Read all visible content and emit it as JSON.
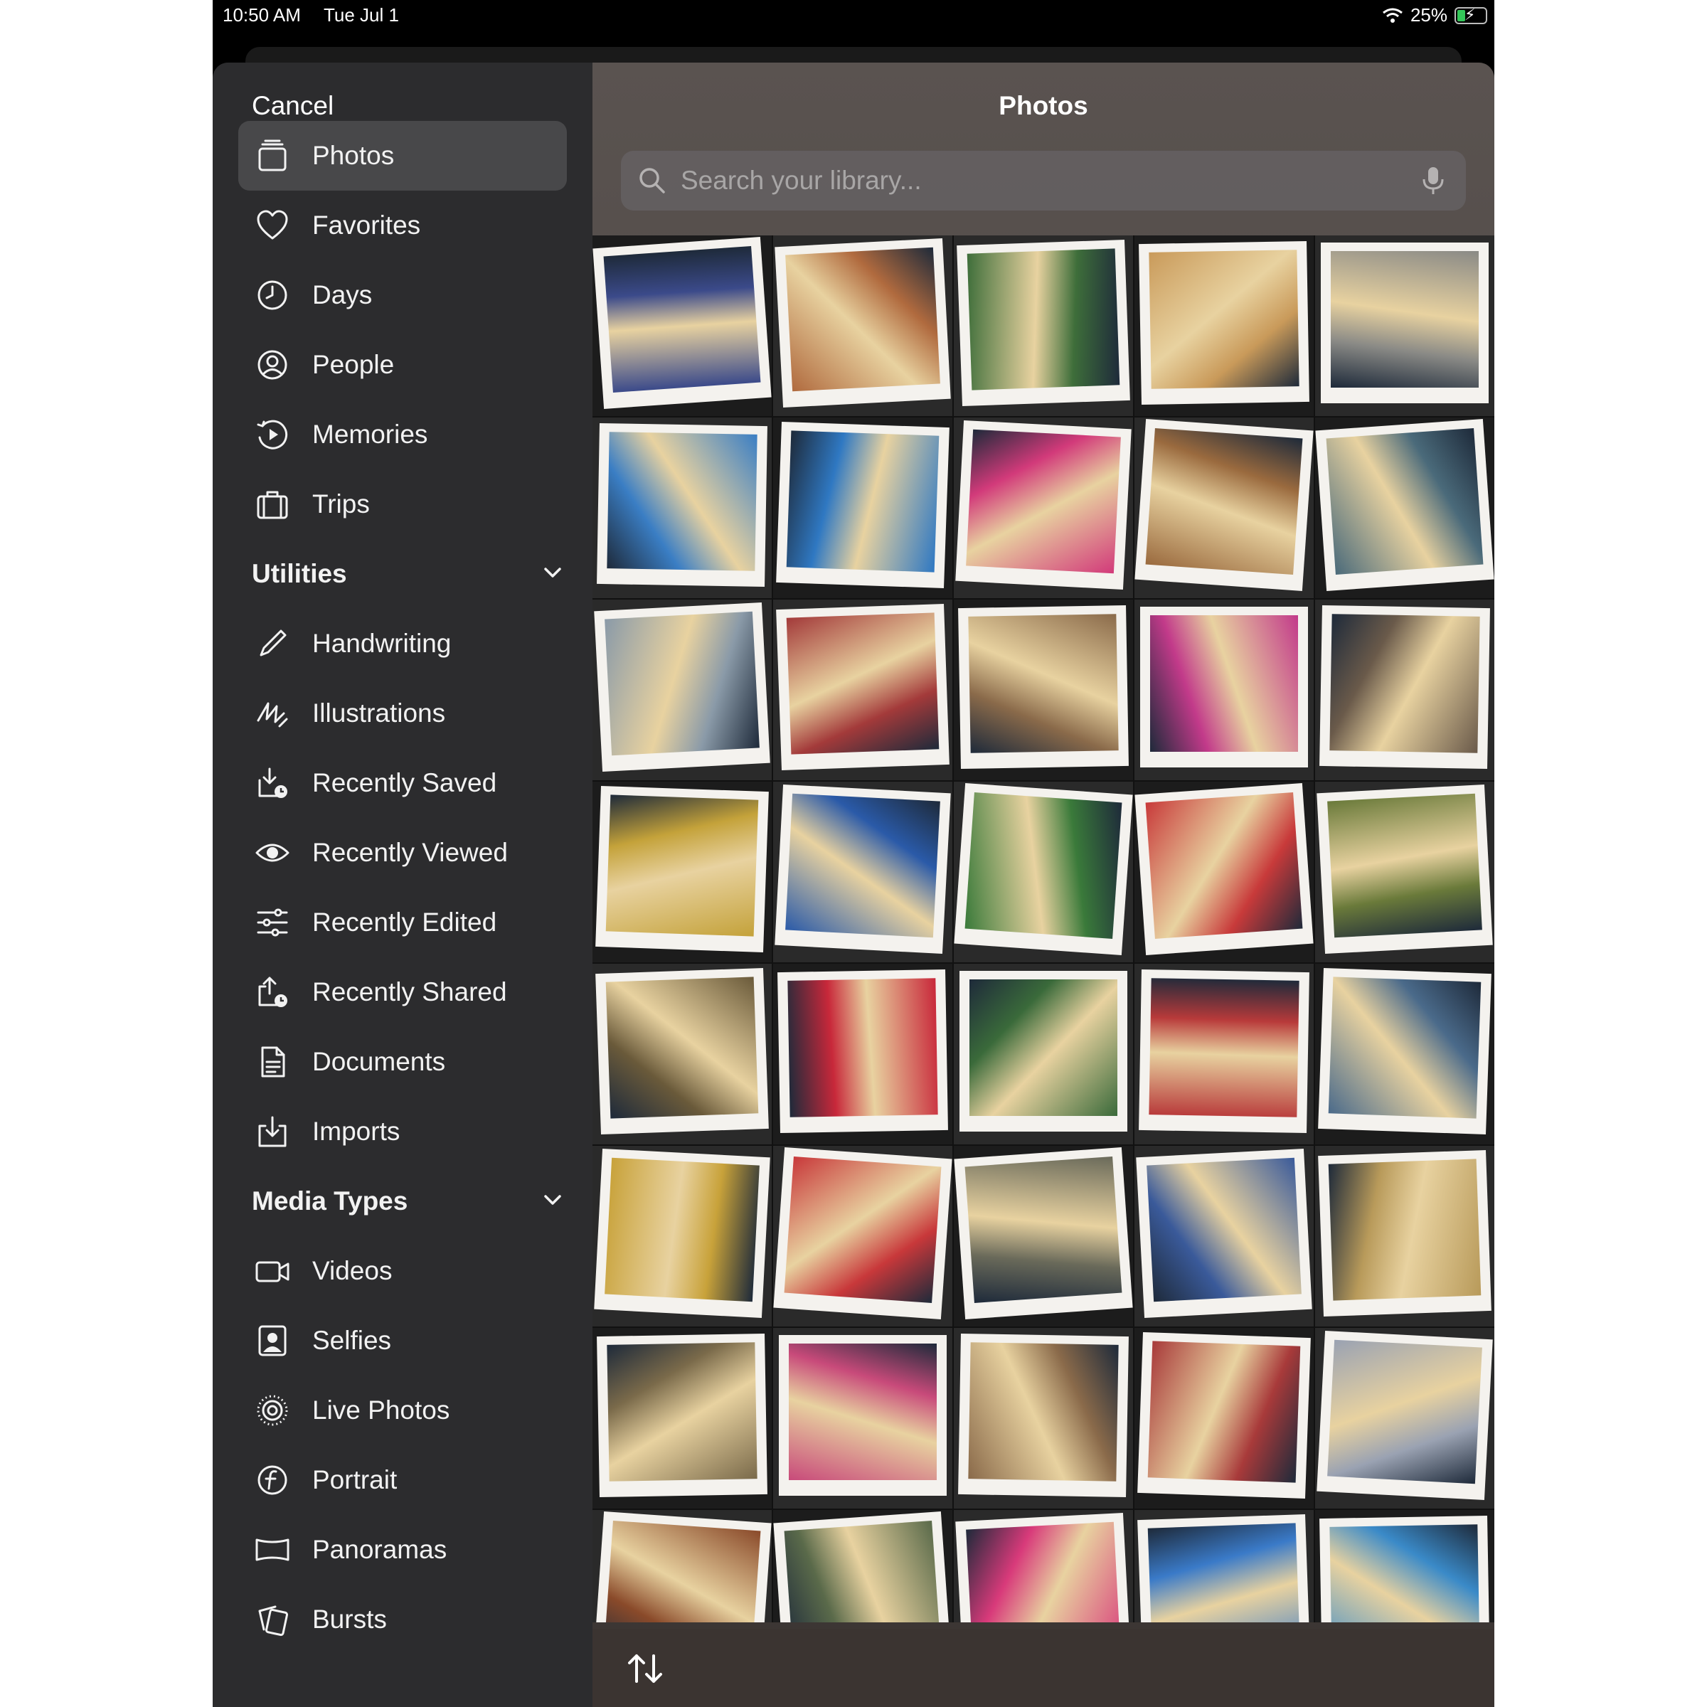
{
  "status_bar": {
    "time": "10:50 AM",
    "date": "Tue Jul 1",
    "battery": "25%",
    "battery_level": 0.25
  },
  "sidebar": {
    "cancel_label": "Cancel",
    "items": [
      {
        "label": "Photos",
        "icon": "photos-stack-icon",
        "selected": true
      },
      {
        "label": "Favorites",
        "icon": "heart-icon"
      },
      {
        "label": "Days",
        "icon": "clock-icon"
      },
      {
        "label": "People",
        "icon": "person-circle-icon"
      },
      {
        "label": "Memories",
        "icon": "memories-play-icon"
      },
      {
        "label": "Trips",
        "icon": "suitcase-icon"
      }
    ],
    "utilities": {
      "title": "Utilities",
      "items": [
        {
          "label": "Handwriting",
          "icon": "pencil-icon"
        },
        {
          "label": "Illustrations",
          "icon": "scribble-icon"
        },
        {
          "label": "Recently Saved",
          "icon": "tray-clock-icon"
        },
        {
          "label": "Recently Viewed",
          "icon": "eye-icon"
        },
        {
          "label": "Recently Edited",
          "icon": "sliders-icon"
        },
        {
          "label": "Recently Shared",
          "icon": "share-clock-icon"
        },
        {
          "label": "Documents",
          "icon": "document-icon"
        },
        {
          "label": "Imports",
          "icon": "import-tray-icon"
        }
      ]
    },
    "media_types": {
      "title": "Media Types",
      "items": [
        {
          "label": "Videos",
          "icon": "video-camera-icon"
        },
        {
          "label": "Selfies",
          "icon": "selfie-icon"
        },
        {
          "label": "Live Photos",
          "icon": "live-photo-icon"
        },
        {
          "label": "Portrait",
          "icon": "portrait-f-icon"
        },
        {
          "label": "Panoramas",
          "icon": "panorama-icon"
        },
        {
          "label": "Bursts",
          "icon": "bursts-icon"
        }
      ]
    }
  },
  "main": {
    "title": "Photos",
    "search_placeholder": "Search your library...",
    "photos": [
      "#3b4a8a",
      "#b06a3e",
      "#3e6e3a",
      "#c99a5a",
      "#8a8a86",
      "#3a7ec4",
      "#2f78c2",
      "#d23a7a",
      "#9a6a3e",
      "#4a6a7a",
      "#8a9aa8",
      "#a33a3a",
      "#8a6a4a",
      "#c23a8a",
      "#6a5a4a",
      "#c4a23a",
      "#2a5aa8",
      "#3a7a3a",
      "#c83a3a",
      "#6a7a3a",
      "#6a5a3a",
      "#c8283a",
      "#3a6a3a",
      "#b83a3a",
      "#4a6a8a",
      "#c8a23a",
      "#c8383a",
      "#6a6a5a",
      "#3a5a9a",
      "#b89a5a",
      "#7a6a4a",
      "#c84a7a",
      "#8a6a4a",
      "#a83a3a",
      "#9aa2b2",
      "#8a4a2a",
      "#5a6a4a",
      "#d83a7a",
      "#3a7ac8",
      "#3a8ac8"
    ]
  }
}
